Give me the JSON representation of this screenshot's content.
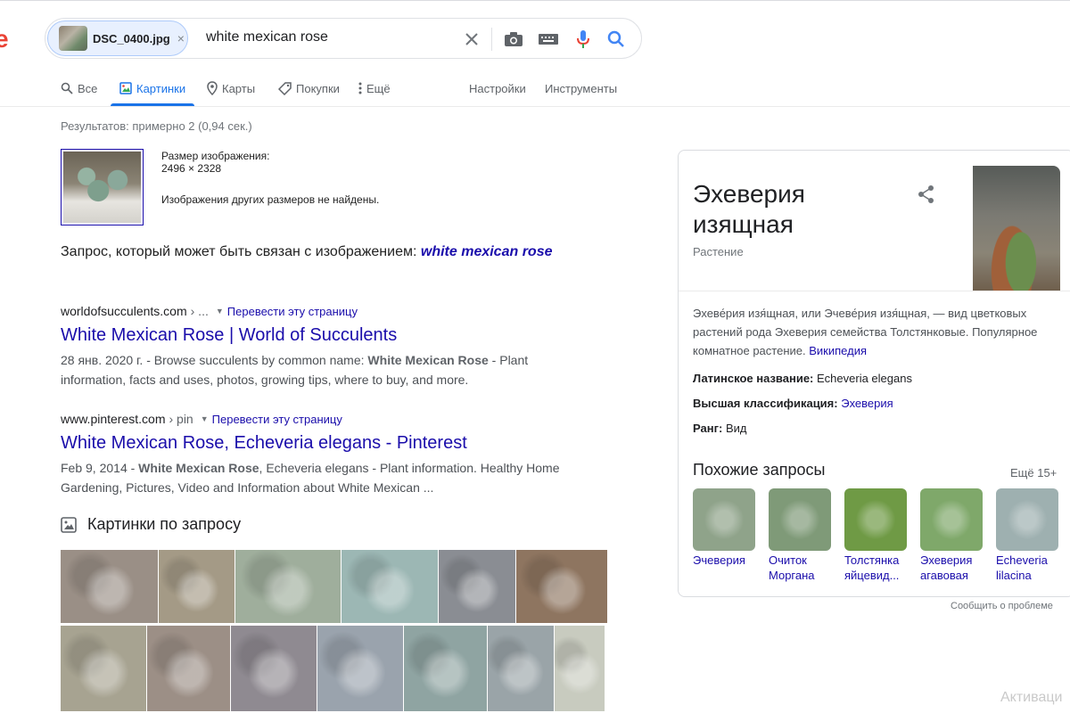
{
  "logo_fragment": "e",
  "search": {
    "chip_filename": "DSC_0400.jpg",
    "chip_close": "×",
    "query": "white mexican rose"
  },
  "tabs": [
    {
      "label": "Все",
      "icon": "search-icon"
    },
    {
      "label": "Картинки",
      "icon": "image-icon"
    },
    {
      "label": "Карты",
      "icon": "pin-icon"
    },
    {
      "label": "Покупки",
      "icon": "tag-icon"
    },
    {
      "label": "Ещё",
      "icon": "more-icon"
    }
  ],
  "tools": {
    "settings": "Настройки",
    "tools": "Инструменты"
  },
  "result_stats": "Результатов: примерно 2 (0,94 сек.)",
  "image_info": {
    "size_label": "Размер изображения:",
    "size_value": "2496 × 2328",
    "not_found": "Изображения других размеров не найдены."
  },
  "related_query": {
    "prefix": "Запрос, который может быть связан с изображением:",
    "link": "white mexican rose"
  },
  "results": [
    {
      "domain": "worldofsucculents.com",
      "crumb": "› ...",
      "translate": "Перевести эту страницу",
      "title": "White Mexican Rose | World of Succulents",
      "snippet_pre": "28 янв. 2020 г. - Browse succulents by common name: ",
      "snippet_bold": "White Mexican Rose",
      "snippet_post": " - Plant information, facts and uses, photos, growing tips, where to buy, and more."
    },
    {
      "domain": "www.pinterest.com",
      "crumb": "› pin",
      "translate": "Перевести эту страницу",
      "title": "White Mexican Rose, Echeveria elegans - Pinterest",
      "snippet_pre": "Feb 9, 2014 - ",
      "snippet_bold": "White Mexican Rose",
      "snippet_post": ", Echeveria elegans - Plant information. Healthy Home Gardening, Pictures, Video and Information about White Mexican ..."
    }
  ],
  "images_section_title": "Картинки по запросу",
  "image_grid_colors": {
    "row1": [
      "#9a8f86",
      "#a49a86",
      "#9fae9c",
      "#9cb7b4",
      "#8a8d93",
      "#8e7560"
    ],
    "row2": [
      "#a7a391",
      "#9c8f86",
      "#8f8a91",
      "#9aa3ad",
      "#8fa4a2",
      "#9aa4a8",
      "#c8cbbf"
    ]
  },
  "knowledge_panel": {
    "title": "Эхеверия изящная",
    "subtitle": "Растение",
    "description": "Эхеве́рия изя́щная, или Эчеве́рия изя́щная, — вид цветковых растений рода Эхеверия семейства Толстянковые. Популярное комнатное растение.",
    "source": "Википедия",
    "facts": [
      {
        "label": "Латинское название:",
        "value": "Echeveria elegans",
        "link": false
      },
      {
        "label": "Высшая классификация:",
        "value": "Эхеверия",
        "link": true
      },
      {
        "label": "Ранг:",
        "value": "Вид",
        "link": false
      }
    ],
    "similar_title": "Похожие запросы",
    "similar_more": "Ещё 15+",
    "similar": [
      {
        "label": "Эчеверия",
        "color": "#8fa38a"
      },
      {
        "label": "Очиток Моргана",
        "color": "#7f9a78"
      },
      {
        "label": "Толстянка яйцевид...",
        "color": "#6f9a45"
      },
      {
        "label": "Эхеверия агавовая",
        "color": "#7fa86a"
      },
      {
        "label": "Echeveria lilacina",
        "color": "#9eb0b0"
      }
    ]
  },
  "feedback": "Сообщить о проблеме",
  "watermark": "Активаци",
  "accent": "#1a73e8",
  "link_color": "#1a0dab"
}
